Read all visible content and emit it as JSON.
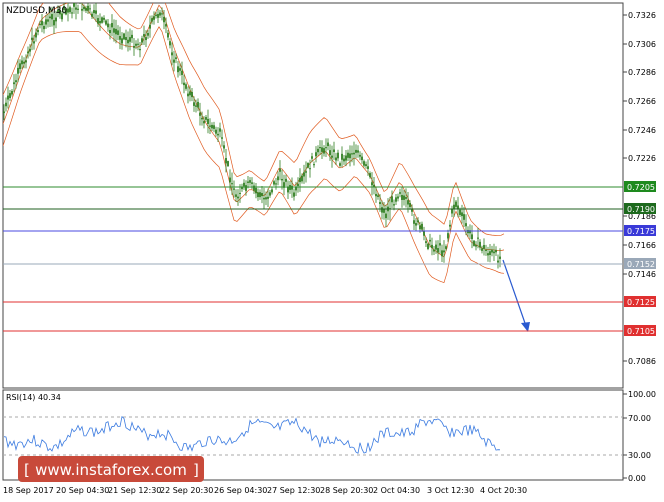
{
  "symbol_label": "NZDUSD,M30",
  "rsi_label": "RSI(14) 40.34",
  "watermark": "www.instaforex.com",
  "colors": {
    "candle": "#2e7d1f",
    "bands": "#e05a1f",
    "green_line": "#2e8b2e",
    "dark_green_line": "#1f5f1f",
    "blue_line": "#4a4ae0",
    "gray_line": "#9aa8b8",
    "red_line": "#e03030",
    "arrow": "#2a5ad0",
    "rsi_line": "#3a7ae0",
    "label_green": "#1e8a1e",
    "label_blue": "#3a3ad8",
    "label_gray": "#9aa8b8",
    "label_red": "#e03030"
  },
  "price_axis": {
    "ticks": [
      "0.7326",
      "0.7306",
      "0.7286",
      "0.7266",
      "0.7246",
      "0.7226",
      "0.7186",
      "0.7166",
      "0.7146",
      "0.7086"
    ]
  },
  "levels": [
    {
      "name": "level-7205",
      "label": "0.7205",
      "kind": "green"
    },
    {
      "name": "level-7190",
      "label": "0.7190",
      "kind": "dark_green"
    },
    {
      "name": "level-7175",
      "label": "0.7175",
      "kind": "blue"
    },
    {
      "name": "level-7152",
      "label": "0.7152",
      "kind": "gray"
    },
    {
      "name": "level-7125",
      "label": "0.7125",
      "kind": "red"
    },
    {
      "name": "level-7105",
      "label": "0.7105",
      "kind": "red"
    }
  ],
  "rsi_axis": {
    "ticks": [
      "100.00",
      "70.00",
      "30.00",
      "0.00"
    ]
  },
  "time_axis": {
    "labels": [
      "18 Sep 2017",
      "20 Sep 04:30",
      "21 Sep 12:30",
      "22 Sep 20:30",
      "26 Sep 04:30",
      "27 Sep 12:30",
      "28 Sep 20:30",
      "2 Oct 04:30",
      "3 Oct 12:30",
      "4 Oct 20:30"
    ]
  }
}
